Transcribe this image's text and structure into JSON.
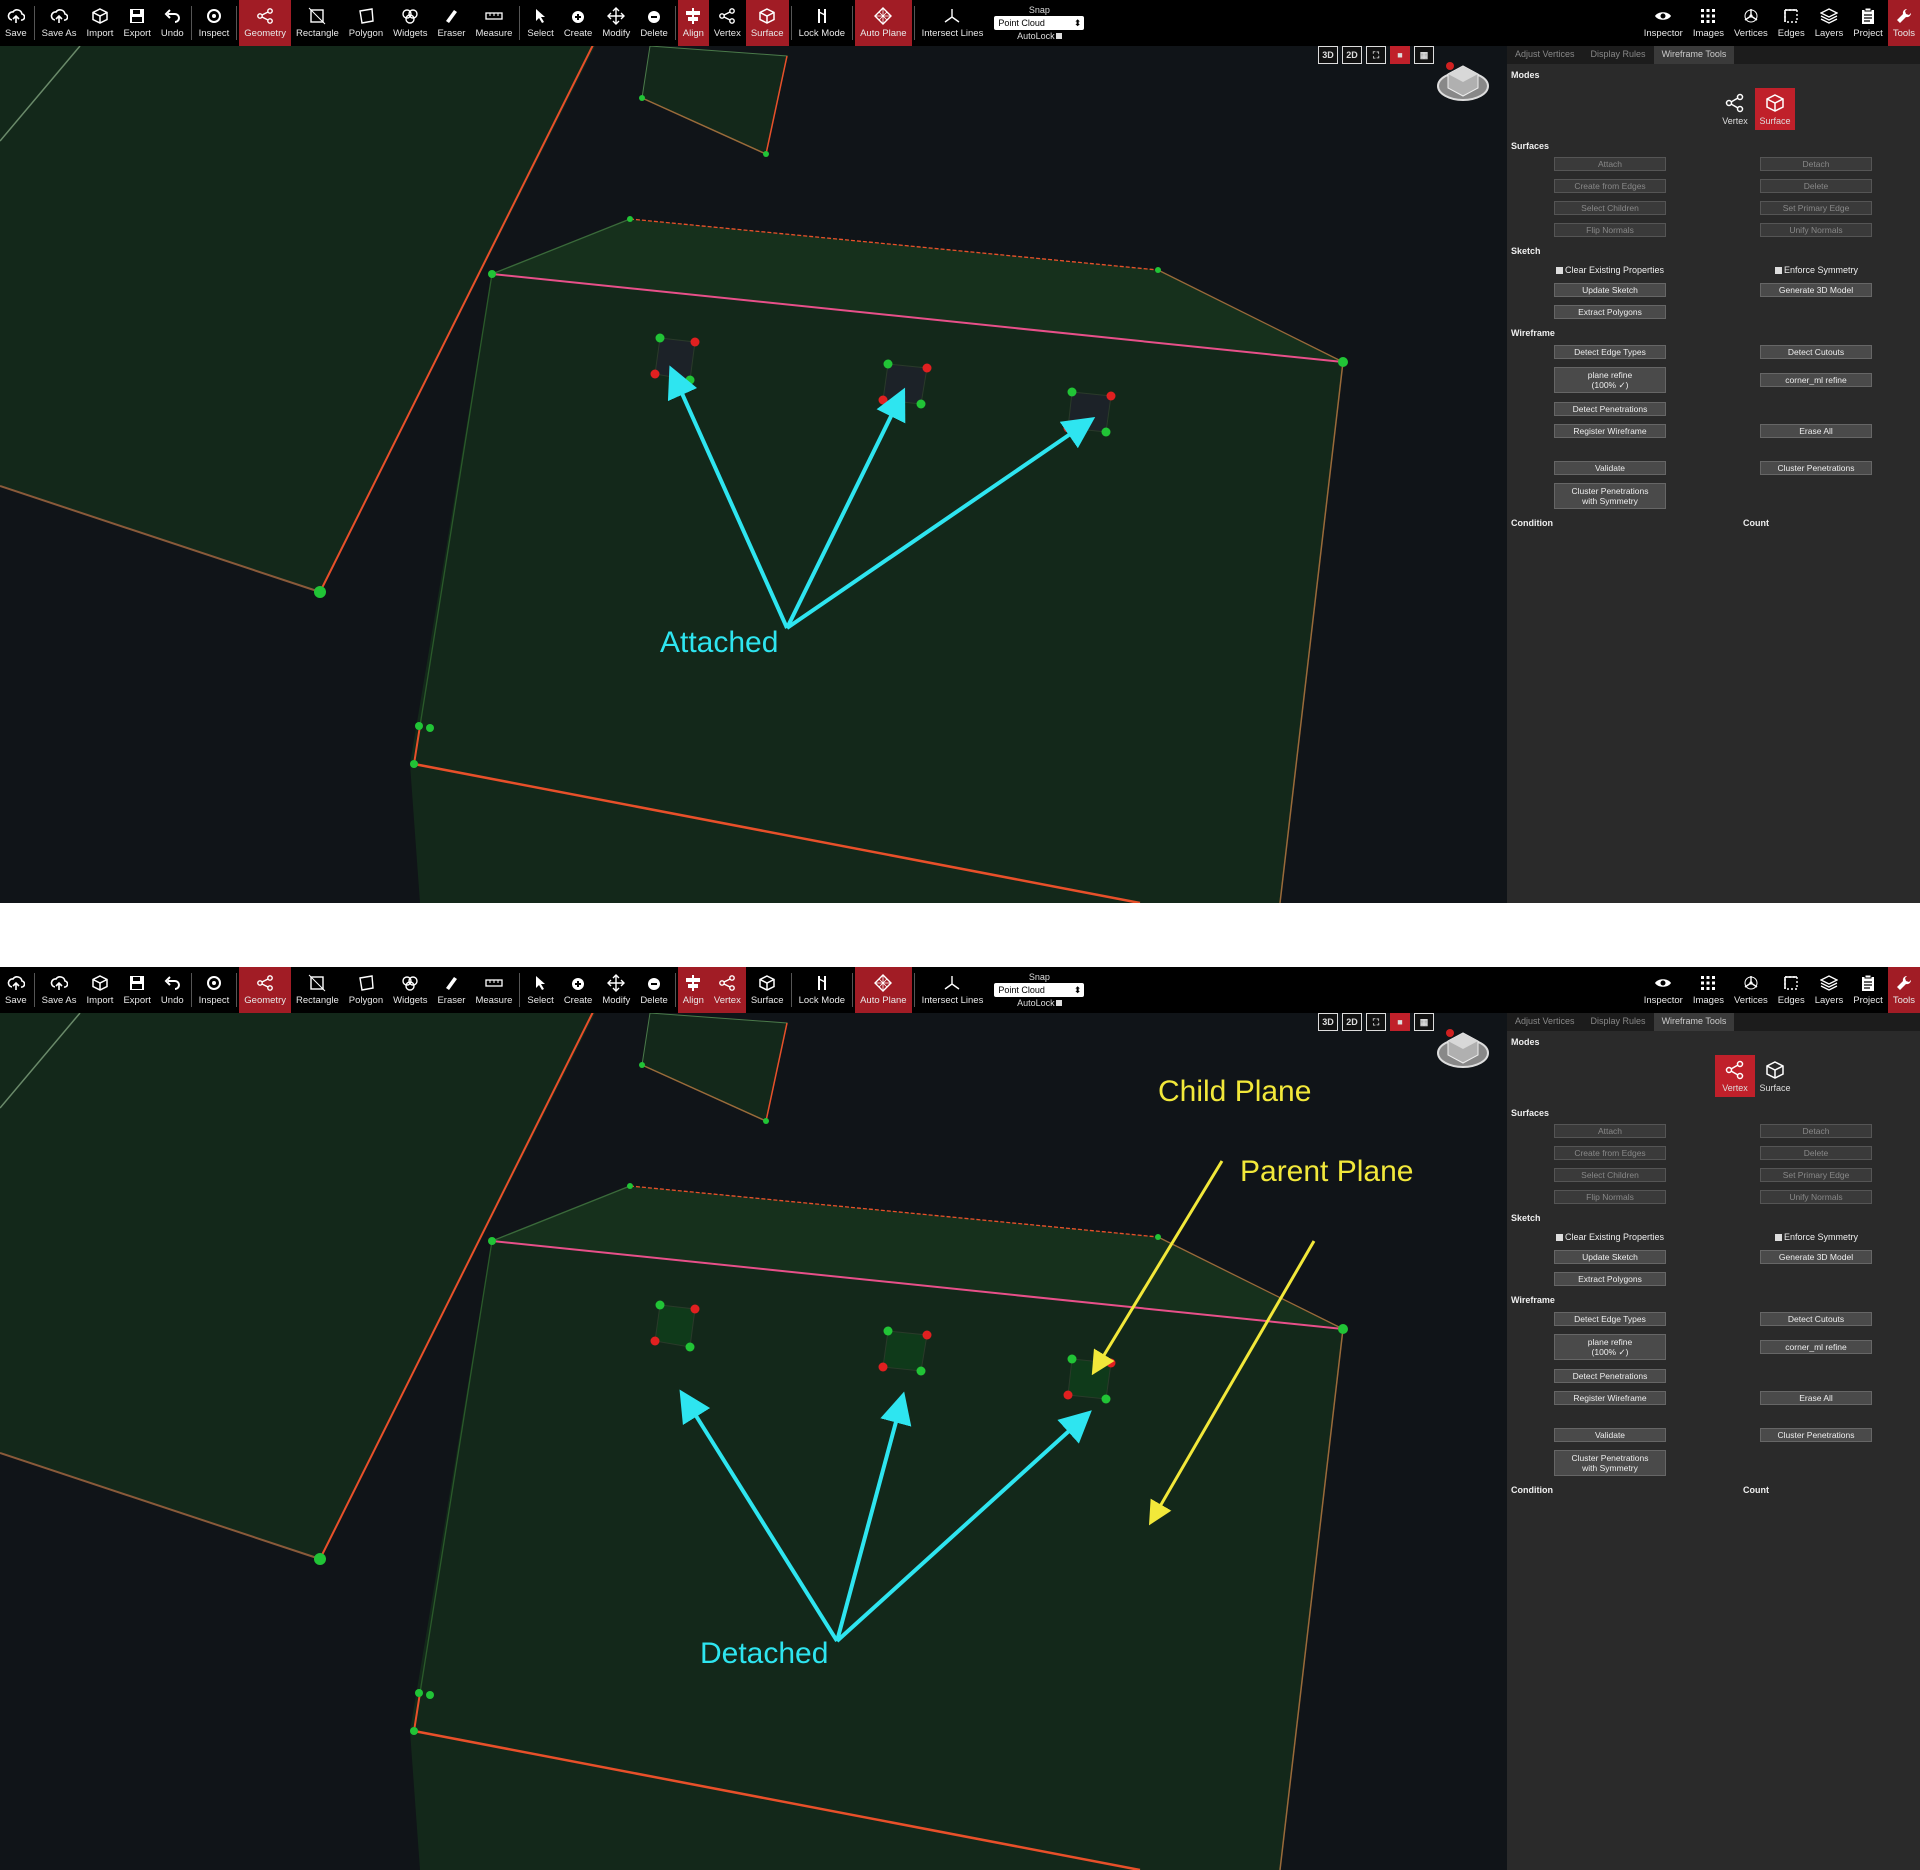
{
  "toolbar": {
    "items": [
      {
        "label": "Save",
        "icon": "cloud-upload-icon",
        "active": false
      },
      {
        "label": "Save As",
        "icon": "cloud-upload-icon",
        "active": false
      },
      {
        "label": "Import",
        "icon": "cube-icon",
        "active": false
      },
      {
        "label": "Export",
        "icon": "floppy-disk-icon",
        "active": false
      },
      {
        "label": "Undo",
        "icon": "undo-icon",
        "active": false
      },
      {
        "label": "Inspect",
        "icon": "target-icon",
        "active": false
      },
      {
        "label": "Geometry",
        "icon": "share-nodes-icon",
        "active": true
      },
      {
        "label": "Rectangle",
        "icon": "rectangle-icon",
        "active": false
      },
      {
        "label": "Polygon",
        "icon": "polygon-icon",
        "active": false
      },
      {
        "label": "Widgets",
        "icon": "widgets-icon",
        "active": false
      },
      {
        "label": "Eraser",
        "icon": "eraser-icon",
        "active": false
      },
      {
        "label": "Measure",
        "icon": "ruler-icon",
        "active": false
      },
      {
        "label": "Select",
        "icon": "cursor-icon",
        "active": false
      },
      {
        "label": "Create",
        "icon": "plus-circle-icon",
        "active": false
      },
      {
        "label": "Modify",
        "icon": "move-arrows-icon",
        "active": false
      },
      {
        "label": "Delete",
        "icon": "minus-circle-icon",
        "active": false
      },
      {
        "label": "Align",
        "icon": "align-icon",
        "active": true
      },
      {
        "label": "Vertex",
        "icon": "share-nodes-icon",
        "active": false
      },
      {
        "label": "Surface",
        "icon": "cube-icon",
        "active": false
      },
      {
        "label": "Lock Mode",
        "icon": "lock-mode-icon",
        "active": false
      },
      {
        "label": "Auto Plane",
        "icon": "auto-plane-icon",
        "active": true
      },
      {
        "label": "Intersect Lines",
        "icon": "axes-icon",
        "active": false
      }
    ],
    "snap_label": "Snap",
    "snap_value": "Point Cloud",
    "autolock_label": "AutoLock",
    "right_items": [
      {
        "label": "Inspector",
        "icon": "eye-icon",
        "active": false
      },
      {
        "label": "Images",
        "icon": "grid-icon",
        "active": false
      },
      {
        "label": "Vertices",
        "icon": "vertices-icon",
        "active": false
      },
      {
        "label": "Edges",
        "icon": "edges-icon",
        "active": false
      },
      {
        "label": "Layers",
        "icon": "layers-icon",
        "active": false
      },
      {
        "label": "Project",
        "icon": "clipboard-icon",
        "active": false
      },
      {
        "label": "Tools",
        "icon": "wrench-icon",
        "active": true
      }
    ]
  },
  "view_buttons": [
    "3D",
    "2D"
  ],
  "panel": {
    "tabs": [
      "Adjust Vertices",
      "Display Rules",
      "Wireframe Tools"
    ],
    "active_tab": "Wireframe Tools",
    "modes_title": "Modes",
    "modes": [
      "Vertex",
      "Surface"
    ],
    "surfaces_title": "Surfaces",
    "surfaces_left": [
      "Attach",
      "Create from Edges",
      "Select Children",
      "Flip Normals"
    ],
    "surfaces_right": [
      "Detach",
      "Delete",
      "Set Primary Edge",
      "Unify Normals"
    ],
    "sketch_title": "Sketch",
    "sketch_chk_left": "Clear Existing Properties",
    "sketch_chk_right": "Enforce Symmetry",
    "update_sketch": "Update Sketch",
    "generate_3d": "Generate 3D Model",
    "extract_polygons": "Extract Polygons",
    "wireframe_title": "Wireframe",
    "detect_edge_types": "Detect Edge Types",
    "detect_cutouts": "Detect Cutouts",
    "plane_refine": "plane refine",
    "plane_refine_sub": "(100% ✓)",
    "corner_ml_refine": "corner_ml refine",
    "detect_penetrations": "Detect Penetrations",
    "register_wireframe": "Register Wireframe",
    "erase_all": "Erase All",
    "validate": "Validate",
    "cluster_penetrations": "Cluster Penetrations",
    "cluster_sym_1": "Cluster Penetrations",
    "cluster_sym_2": "with Symmetry",
    "condition_label": "Condition",
    "count_label": "Count"
  },
  "panels": {
    "top": {
      "active_mode": "Surface",
      "active_toolbar_mode": "Surface"
    },
    "bottom": {
      "active_mode": "Vertex",
      "active_toolbar_mode": "Vertex"
    }
  },
  "annotations": {
    "top": {
      "label": "Attached",
      "color": "#2ee5f0"
    },
    "bottom": {
      "detached": "Detached",
      "detached_color": "#2ee5f0",
      "child_plane": "Child Plane",
      "parent_plane": "Parent Plane",
      "plane_color": "#f2e83a"
    }
  },
  "colors": {
    "toolbar_active": "#a11c25",
    "panel_bg": "#2a2a2a",
    "viewport_bg": "#101418",
    "plane_fill": "#13281a",
    "edge_red": "#e8502a",
    "edge_pink": "#e8508a",
    "vertex_green": "#21c436",
    "vertex_red": "#e02020"
  }
}
